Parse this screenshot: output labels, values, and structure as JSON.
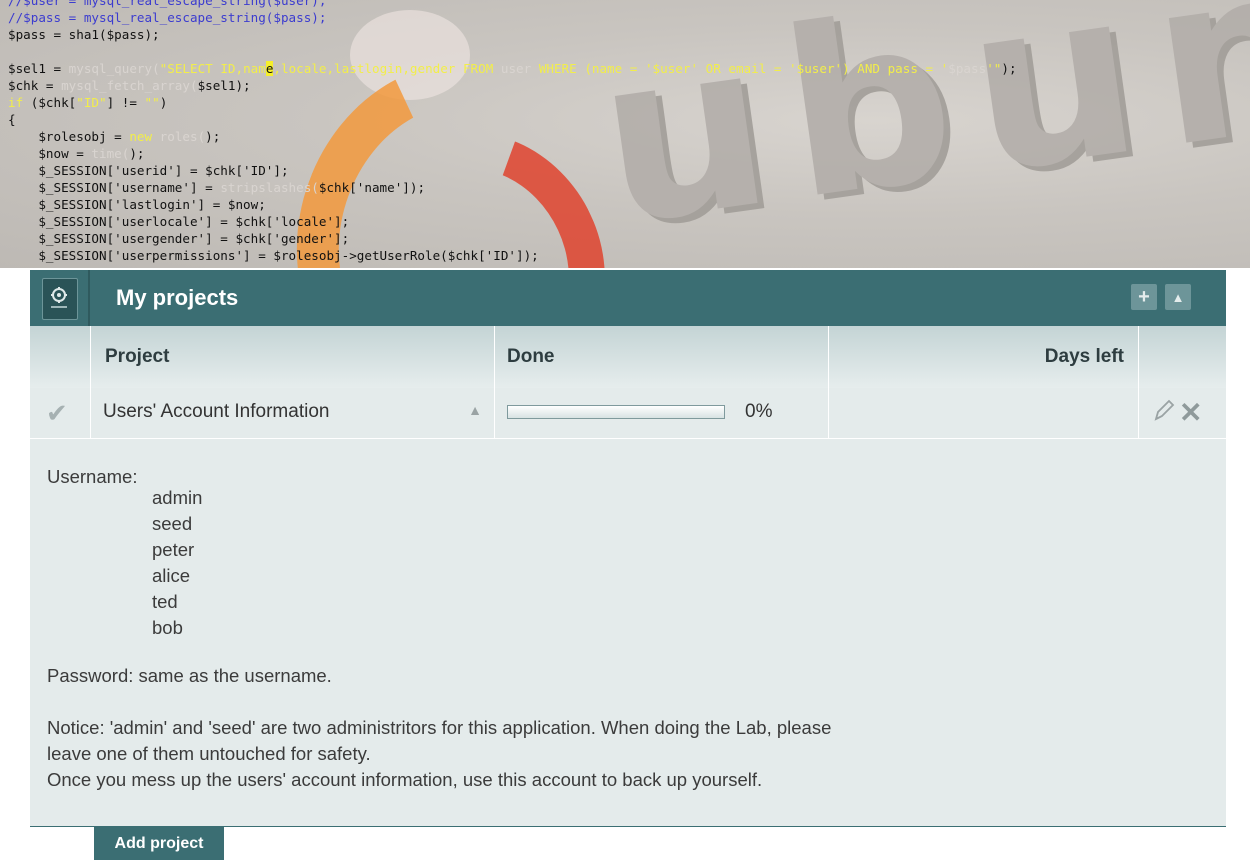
{
  "code": {
    "lines": [
      [
        [
          "c-com",
          "//$user = mysql_real_escape_string($user);"
        ]
      ],
      [
        [
          "c-com",
          "//$pass = mysql_real_escape_string($pass);"
        ]
      ],
      [
        [
          "c-plain",
          "$pass = sha1($pass);"
        ]
      ],
      [
        [
          "c-plain",
          ""
        ]
      ],
      [
        [
          "c-plain",
          "$sel1 = "
        ],
        [
          "c-dim",
          "mysql_query("
        ],
        [
          "c-str",
          "\"SELECT ID,nam"
        ],
        [
          "caret",
          "e"
        ],
        [
          "c-str",
          ",locale,lastlogin,gender FROM "
        ],
        [
          "c-dim",
          "user "
        ],
        [
          "c-str",
          "WHERE "
        ],
        [
          "c-str",
          "(name = '$user' OR email = '$user') AND pass = '"
        ],
        [
          "c-dim",
          "$pass"
        ],
        [
          "c-str",
          "'\""
        ],
        [
          "c-plain",
          ");"
        ]
      ],
      [
        [
          "c-plain",
          "$chk = "
        ],
        [
          "c-dim",
          "mysql_fetch_array("
        ],
        [
          "c-plain",
          "$sel1);"
        ]
      ],
      [
        [
          "c-str",
          "if"
        ],
        [
          "c-plain",
          " ($chk["
        ],
        [
          "c-str",
          "\"ID\""
        ],
        [
          "c-plain",
          "] != "
        ],
        [
          "c-str",
          "\"\""
        ],
        [
          "c-plain",
          ")"
        ]
      ],
      [
        [
          "c-plain",
          "{"
        ]
      ],
      [
        [
          "c-plain",
          "    $rolesobj = "
        ],
        [
          "c-str",
          "new"
        ],
        [
          "c-dim",
          " roles("
        ],
        [
          "c-plain",
          ");"
        ]
      ],
      [
        [
          "c-plain",
          "    $now = "
        ],
        [
          "c-dim",
          "time("
        ],
        [
          "c-plain",
          ");"
        ]
      ],
      [
        [
          "c-plain",
          "    $_SESSION['userid'] = $chk['ID'];"
        ]
      ],
      [
        [
          "c-plain",
          "    $_SESSION['username'] = "
        ],
        [
          "c-dim",
          "stripslashes("
        ],
        [
          "c-plain",
          "$chk['name']);"
        ]
      ],
      [
        [
          "c-plain",
          "    $_SESSION['lastlogin'] = $now;"
        ]
      ],
      [
        [
          "c-plain",
          "    $_SESSION['userlocale'] = $chk['locale'];"
        ]
      ],
      [
        [
          "c-plain",
          "    $_SESSION['usergender'] = $chk['gender'];"
        ]
      ],
      [
        [
          "c-plain",
          "    $_SESSION['userpermissions'] = $rolesobj->getUserRole($chk['ID']);"
        ]
      ]
    ],
    "wallpaper_text": "ubun"
  },
  "panel": {
    "title": "My projects",
    "add_icon": "plus-icon",
    "collapse_icon": "triangle-up-icon",
    "columns": {
      "project": "Project",
      "done": "Done",
      "days_left": "Days left"
    },
    "row": {
      "name": "Users' Account Information",
      "done_fraction": 0.0,
      "done_label": "0%",
      "days_left": ""
    },
    "description": {
      "username_label": "Username:",
      "users": [
        "admin",
        "seed",
        "peter",
        "alice",
        "ted",
        "bob"
      ],
      "password_line": "Password: same as the username.",
      "notice_line1": "Notice: 'admin' and 'seed' are two administritors for this application. When doing the Lab, please",
      "notice_line2": "leave one of them untouched for safety.",
      "notice_line3": "Once you mess up the users' account information, use this account to back up yourself."
    },
    "add_project_label": "Add project"
  },
  "colors": {
    "accent": "#3b6e73",
    "panel_bg": "#e4ebeb"
  }
}
